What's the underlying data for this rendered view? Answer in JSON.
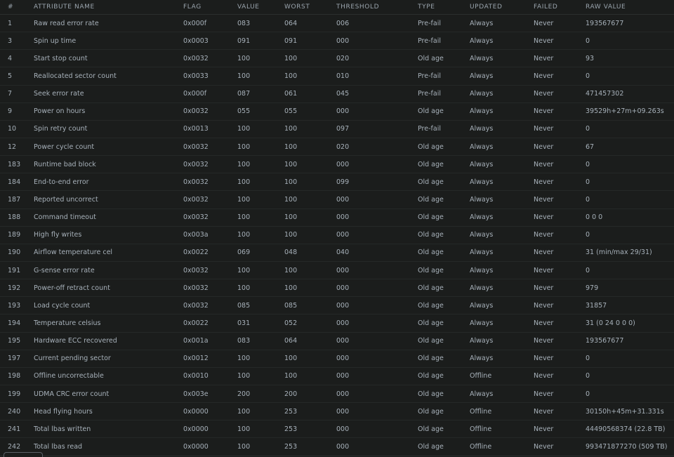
{
  "table": {
    "headers": {
      "id": "#",
      "name": "ATTRIBUTE NAME",
      "flag": "FLAG",
      "value": "VALUE",
      "worst": "WORST",
      "threshold": "THRESHOLD",
      "type": "TYPE",
      "updated": "UPDATED",
      "failed": "FAILED",
      "raw": "RAW VALUE"
    },
    "rows": [
      {
        "id": "1",
        "name": "Raw read error rate",
        "flag": "0x000f",
        "value": "083",
        "worst": "064",
        "threshold": "006",
        "type": "Pre-fail",
        "updated": "Always",
        "failed": "Never",
        "raw": "193567677"
      },
      {
        "id": "3",
        "name": "Spin up time",
        "flag": "0x0003",
        "value": "091",
        "worst": "091",
        "threshold": "000",
        "type": "Pre-fail",
        "updated": "Always",
        "failed": "Never",
        "raw": "0"
      },
      {
        "id": "4",
        "name": "Start stop count",
        "flag": "0x0032",
        "value": "100",
        "worst": "100",
        "threshold": "020",
        "type": "Old age",
        "updated": "Always",
        "failed": "Never",
        "raw": "93"
      },
      {
        "id": "5",
        "name": "Reallocated sector count",
        "flag": "0x0033",
        "value": "100",
        "worst": "100",
        "threshold": "010",
        "type": "Pre-fail",
        "updated": "Always",
        "failed": "Never",
        "raw": "0"
      },
      {
        "id": "7",
        "name": "Seek error rate",
        "flag": "0x000f",
        "value": "087",
        "worst": "061",
        "threshold": "045",
        "type": "Pre-fail",
        "updated": "Always",
        "failed": "Never",
        "raw": "471457302"
      },
      {
        "id": "9",
        "name": "Power on hours",
        "flag": "0x0032",
        "value": "055",
        "worst": "055",
        "threshold": "000",
        "type": "Old age",
        "updated": "Always",
        "failed": "Never",
        "raw": "39529h+27m+09.263s"
      },
      {
        "id": "10",
        "name": "Spin retry count",
        "flag": "0x0013",
        "value": "100",
        "worst": "100",
        "threshold": "097",
        "type": "Pre-fail",
        "updated": "Always",
        "failed": "Never",
        "raw": "0"
      },
      {
        "id": "12",
        "name": "Power cycle count",
        "flag": "0x0032",
        "value": "100",
        "worst": "100",
        "threshold": "020",
        "type": "Old age",
        "updated": "Always",
        "failed": "Never",
        "raw": "67"
      },
      {
        "id": "183",
        "name": "Runtime bad block",
        "flag": "0x0032",
        "value": "100",
        "worst": "100",
        "threshold": "000",
        "type": "Old age",
        "updated": "Always",
        "failed": "Never",
        "raw": "0"
      },
      {
        "id": "184",
        "name": "End-to-end error",
        "flag": "0x0032",
        "value": "100",
        "worst": "100",
        "threshold": "099",
        "type": "Old age",
        "updated": "Always",
        "failed": "Never",
        "raw": "0"
      },
      {
        "id": "187",
        "name": "Reported uncorrect",
        "flag": "0x0032",
        "value": "100",
        "worst": "100",
        "threshold": "000",
        "type": "Old age",
        "updated": "Always",
        "failed": "Never",
        "raw": "0"
      },
      {
        "id": "188",
        "name": "Command timeout",
        "flag": "0x0032",
        "value": "100",
        "worst": "100",
        "threshold": "000",
        "type": "Old age",
        "updated": "Always",
        "failed": "Never",
        "raw": "0 0 0"
      },
      {
        "id": "189",
        "name": "High fly writes",
        "flag": "0x003a",
        "value": "100",
        "worst": "100",
        "threshold": "000",
        "type": "Old age",
        "updated": "Always",
        "failed": "Never",
        "raw": "0"
      },
      {
        "id": "190",
        "name": "Airflow temperature cel",
        "flag": "0x0022",
        "value": "069",
        "worst": "048",
        "threshold": "040",
        "type": "Old age",
        "updated": "Always",
        "failed": "Never",
        "raw": "31 (min/max 29/31)"
      },
      {
        "id": "191",
        "name": "G-sense error rate",
        "flag": "0x0032",
        "value": "100",
        "worst": "100",
        "threshold": "000",
        "type": "Old age",
        "updated": "Always",
        "failed": "Never",
        "raw": "0"
      },
      {
        "id": "192",
        "name": "Power-off retract count",
        "flag": "0x0032",
        "value": "100",
        "worst": "100",
        "threshold": "000",
        "type": "Old age",
        "updated": "Always",
        "failed": "Never",
        "raw": "979"
      },
      {
        "id": "193",
        "name": "Load cycle count",
        "flag": "0x0032",
        "value": "085",
        "worst": "085",
        "threshold": "000",
        "type": "Old age",
        "updated": "Always",
        "failed": "Never",
        "raw": "31857"
      },
      {
        "id": "194",
        "name": "Temperature celsius",
        "flag": "0x0022",
        "value": "031",
        "worst": "052",
        "threshold": "000",
        "type": "Old age",
        "updated": "Always",
        "failed": "Never",
        "raw": "31 (0 24 0 0 0)"
      },
      {
        "id": "195",
        "name": "Hardware ECC recovered",
        "flag": "0x001a",
        "value": "083",
        "worst": "064",
        "threshold": "000",
        "type": "Old age",
        "updated": "Always",
        "failed": "Never",
        "raw": "193567677"
      },
      {
        "id": "197",
        "name": "Current pending sector",
        "flag": "0x0012",
        "value": "100",
        "worst": "100",
        "threshold": "000",
        "type": "Old age",
        "updated": "Always",
        "failed": "Never",
        "raw": "0"
      },
      {
        "id": "198",
        "name": "Offline uncorrectable",
        "flag": "0x0010",
        "value": "100",
        "worst": "100",
        "threshold": "000",
        "type": "Old age",
        "updated": "Offline",
        "failed": "Never",
        "raw": "0"
      },
      {
        "id": "199",
        "name": "UDMA CRC error count",
        "flag": "0x003e",
        "value": "200",
        "worst": "200",
        "threshold": "000",
        "type": "Old age",
        "updated": "Always",
        "failed": "Never",
        "raw": "0"
      },
      {
        "id": "240",
        "name": "Head flying hours",
        "flag": "0x0000",
        "value": "100",
        "worst": "253",
        "threshold": "000",
        "type": "Old age",
        "updated": "Offline",
        "failed": "Never",
        "raw": "30150h+45m+31.331s"
      },
      {
        "id": "241",
        "name": "Total lbas written",
        "flag": "0x0000",
        "value": "100",
        "worst": "253",
        "threshold": "000",
        "type": "Old age",
        "updated": "Offline",
        "failed": "Never",
        "raw": "44490568374 (22.8 TB)"
      },
      {
        "id": "242",
        "name": "Total lbas read",
        "flag": "0x0000",
        "value": "100",
        "worst": "253",
        "threshold": "000",
        "type": "Old age",
        "updated": "Offline",
        "failed": "Never",
        "raw": "993471877270 (509 TB)"
      }
    ]
  }
}
